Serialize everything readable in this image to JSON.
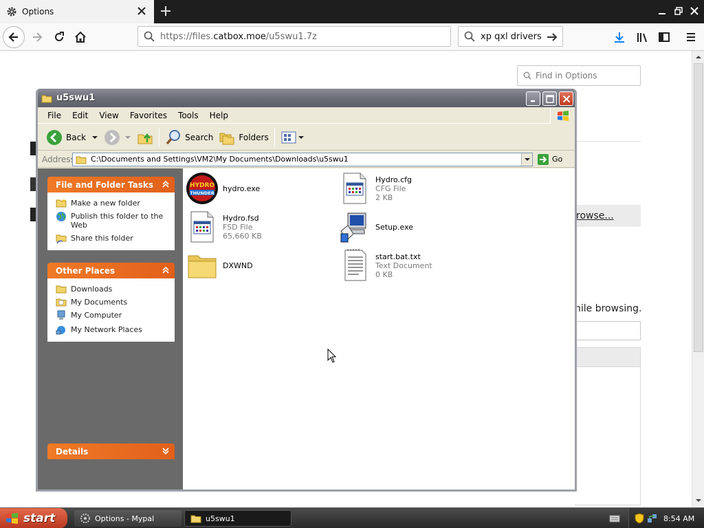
{
  "browser": {
    "tab_title": "Options",
    "url_gray": "https://files.",
    "url_dark": "catbox.moe",
    "url_rest": "/u5swu1.7z",
    "search_value": "xp qxl drivers"
  },
  "options_page": {
    "find_placeholder": "Find in Options",
    "browse_label": "rowse...",
    "while_browsing": "hile browsing."
  },
  "explorer": {
    "title": "u5swu1",
    "menu": [
      "File",
      "Edit",
      "View",
      "Favorites",
      "Tools",
      "Help"
    ],
    "toolbar": {
      "back": "Back",
      "search": "Search",
      "folders": "Folders"
    },
    "address_label": "Address",
    "address_path": "C:\\Documents and Settings\\VM2\\My Documents\\Downloads\\u5swu1",
    "go_label": "Go",
    "tasks_panel": {
      "title": "File and Folder Tasks",
      "items": [
        "Make a new folder",
        "Publish this folder to the Web",
        "Share this folder"
      ]
    },
    "places_panel": {
      "title": "Other Places",
      "items": [
        "Downloads",
        "My Documents",
        "My Computer",
        "My Network Places"
      ]
    },
    "details_panel": {
      "title": "Details"
    },
    "files": [
      {
        "name": "hydro.exe",
        "type": "",
        "size": "",
        "icon": "hydro-thunder-icon"
      },
      {
        "name": "Hydro.cfg",
        "type": "CFG File",
        "size": "2 KB",
        "icon": "generic-file-icon"
      },
      {
        "name": "Hydro.fsd",
        "type": "FSD File",
        "size": "65,660 KB",
        "icon": "generic-file-icon"
      },
      {
        "name": "Setup.exe",
        "type": "",
        "size": "",
        "icon": "setup-icon"
      },
      {
        "name": "DXWND",
        "type": "",
        "size": "",
        "icon": "folder-icon"
      },
      {
        "name": "start.bat.txt",
        "type": "Text Document",
        "size": "0 KB",
        "icon": "text-file-icon"
      }
    ]
  },
  "taskbar": {
    "start_label": "start",
    "tasks": [
      {
        "label": "Options - Mypal"
      },
      {
        "label": "u5swu1"
      }
    ],
    "clock": "8:54 AM"
  }
}
